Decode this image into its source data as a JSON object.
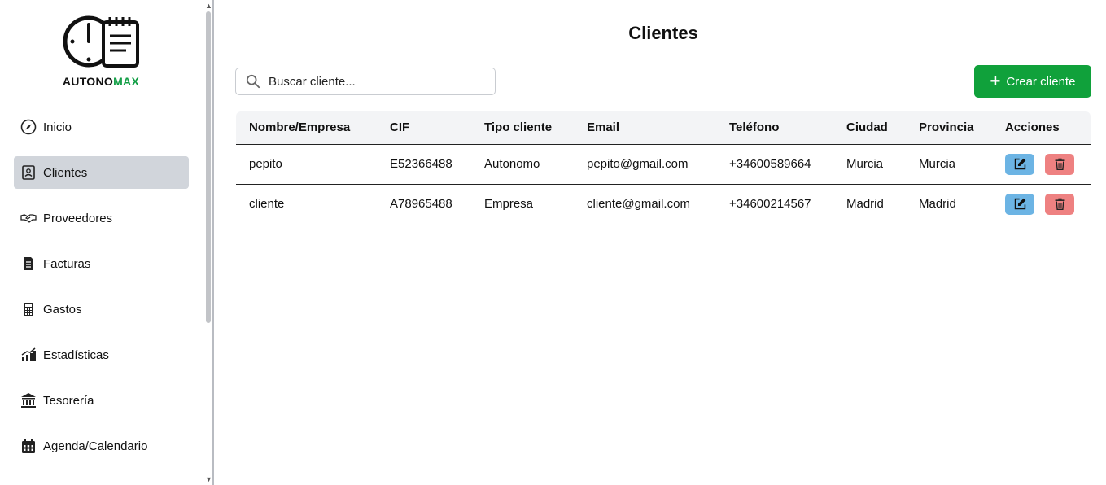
{
  "brand": {
    "part1": "AUTONO",
    "part2": "MAX",
    "accent": "#0f9d43"
  },
  "sidebar": {
    "items": [
      {
        "label": "Inicio",
        "icon": "compass-icon"
      },
      {
        "label": "Clientes",
        "icon": "contact-card-icon",
        "active": true
      },
      {
        "label": "Proveedores",
        "icon": "handshake-icon"
      },
      {
        "label": "Facturas",
        "icon": "invoice-icon"
      },
      {
        "label": "Gastos",
        "icon": "calculator-icon"
      },
      {
        "label": "Estadísticas",
        "icon": "bar-chart-icon"
      },
      {
        "label": "Tesorería",
        "icon": "bank-icon"
      },
      {
        "label": "Agenda/Calendario",
        "icon": "calendar-icon"
      }
    ]
  },
  "main": {
    "title": "Clientes",
    "search": {
      "placeholder": "Buscar cliente...",
      "value": ""
    },
    "create_button": "Crear cliente",
    "create_color": "#10a13b"
  },
  "table": {
    "headers": [
      "Nombre/Empresa",
      "CIF",
      "Tipo cliente",
      "Email",
      "Teléfono",
      "Ciudad",
      "Provincia",
      "Acciones"
    ],
    "rows": [
      [
        "pepito",
        "E52366488",
        "Autonomo",
        "pepito@gmail.com",
        "+34600589664",
        "Murcia",
        "Murcia"
      ],
      [
        "cliente",
        "A78965488",
        "Empresa",
        "cliente@gmail.com",
        "+34600214567",
        "Madrid",
        "Madrid"
      ]
    ]
  },
  "colors": {
    "edit": "#6cb4e4",
    "delete": "#ee8181",
    "active_nav": "#d1d5db"
  }
}
